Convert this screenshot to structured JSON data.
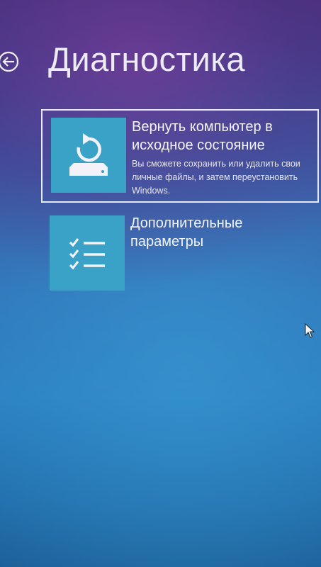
{
  "header": {
    "title": "Диагностика",
    "back_icon": "back-arrow-circle-icon"
  },
  "options": [
    {
      "title": "Вернуть компьютер в исходное состояние",
      "description": "Вы сможете сохранить или удалить свои личные файлы, и затем переустановить Windows.",
      "icon": "reset-refresh-icon",
      "selected": true
    },
    {
      "title": "Дополнительные параметры",
      "description": "",
      "icon": "checklist-icon",
      "selected": false
    }
  ],
  "colors": {
    "tile": "#3aa2c6",
    "text": "#f2f2f8",
    "selection_border": "#e8e8f0"
  }
}
